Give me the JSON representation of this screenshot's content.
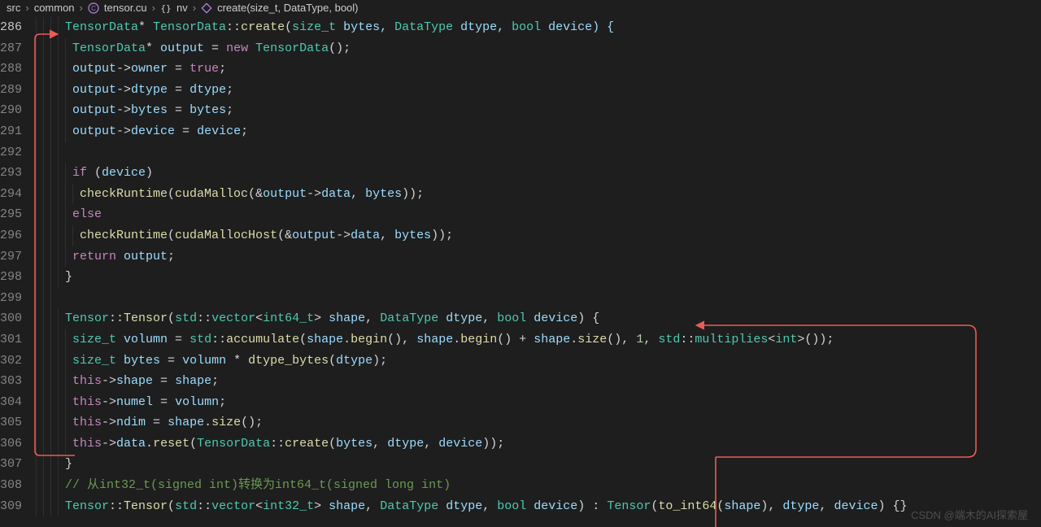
{
  "breadcrumbs": {
    "parts": [
      "src",
      "common",
      "tensor.cu",
      "nv",
      "create(size_t, DataType, bool)"
    ],
    "sep": "›"
  },
  "lines": {
    "start": 286,
    "cur": 286,
    "end": 309
  },
  "code": {
    "l286": {
      "t1": "TensorData",
      "t2": "* ",
      "t3": "TensorData",
      "t4": "::",
      "t5": "create",
      "t6": "(",
      "t7": "size_t",
      "t8": " bytes, ",
      "t9": "DataType",
      "t10": " dtype, ",
      "t11": "bool",
      "t12": " device) {"
    },
    "l287": {
      "t1": "TensorData",
      "t2": "* ",
      "t3": "output",
      "t4": " = ",
      "t5": "new",
      "t6": " ",
      "t7": "TensorData",
      "t8": "();"
    },
    "l288": {
      "t1": "output",
      "t2": "->",
      "t3": "owner",
      "t4": " = ",
      "t5": "true",
      "t6": ";"
    },
    "l289": {
      "t1": "output",
      "t2": "->",
      "t3": "dtype",
      "t4": " = ",
      "t5": "dtype",
      "t6": ";"
    },
    "l290": {
      "t1": "output",
      "t2": "->",
      "t3": "bytes",
      "t4": " = ",
      "t5": "bytes",
      "t6": ";"
    },
    "l291": {
      "t1": "output",
      "t2": "->",
      "t3": "device",
      "t4": " = ",
      "t5": "device",
      "t6": ";"
    },
    "l293": {
      "t1": "if",
      "t2": " (",
      "t3": "device",
      "t4": ")"
    },
    "l294": {
      "t1": "checkRuntime",
      "t2": "(",
      "t3": "cudaMalloc",
      "t4": "(&",
      "t5": "output",
      "t6": "->",
      "t7": "data",
      "t8": ", ",
      "t9": "bytes",
      "t10": "));"
    },
    "l295": {
      "t1": "else"
    },
    "l296": {
      "t1": "checkRuntime",
      "t2": "(",
      "t3": "cudaMallocHost",
      "t4": "(&",
      "t5": "output",
      "t6": "->",
      "t7": "data",
      "t8": ", ",
      "t9": "bytes",
      "t10": "));"
    },
    "l297": {
      "t1": "return",
      "t2": " ",
      "t3": "output",
      "t4": ";"
    },
    "l298": {
      "t1": "}"
    },
    "l300": {
      "t1": "Tensor",
      "t2": "::",
      "t3": "Tensor",
      "t4": "(",
      "t5": "std",
      "t6": "::",
      "t7": "vector",
      "t8": "<",
      "t9": "int64_t",
      "t10": "> ",
      "t11": "shape",
      "t12": ", ",
      "t13": "DataType",
      "t14": " ",
      "t15": "dtype",
      "t16": ", ",
      "t17": "bool",
      "t18": " ",
      "t19": "device",
      "t20": ") {"
    },
    "l301": {
      "t1": "size_t",
      "t2": " ",
      "t3": "volumn",
      "t4": " = ",
      "t5": "std",
      "t6": "::",
      "t7": "accumulate",
      "t8": "(",
      "t9": "shape",
      "t10": ".",
      "t11": "begin",
      "t12": "(), ",
      "t13": "shape",
      "t14": ".",
      "t15": "begin",
      "t16": "() + ",
      "t17": "shape",
      "t18": ".",
      "t19": "size",
      "t20": "(), ",
      "t21": "1",
      "t22": ", ",
      "t23": "std",
      "t24": "::",
      "t25": "multiplies",
      "t26": "<",
      "t27": "int",
      "t28": ">());"
    },
    "l302": {
      "t1": "size_t",
      "t2": " ",
      "t3": "bytes",
      "t4": " = ",
      "t5": "volumn",
      "t6": " * ",
      "t7": "dtype_bytes",
      "t8": "(",
      "t9": "dtype",
      "t10": ");"
    },
    "l303": {
      "t1": "this",
      "t2": "->",
      "t3": "shape",
      "t4": " = ",
      "t5": "shape",
      "t6": ";"
    },
    "l304": {
      "t1": "this",
      "t2": "->",
      "t3": "numel",
      "t4": " = ",
      "t5": "volumn",
      "t6": ";"
    },
    "l305": {
      "t1": "this",
      "t2": "->",
      "t3": "ndim",
      "t4": " = ",
      "t5": "shape",
      "t6": ".",
      "t7": "size",
      "t8": "();"
    },
    "l306": {
      "t1": "this",
      "t2": "->",
      "t3": "data",
      "t4": ".",
      "t5": "reset",
      "t6": "(",
      "t7": "TensorData",
      "t8": "::",
      "t9": "create",
      "t10": "(",
      "t11": "bytes",
      "t12": ", ",
      "t13": "dtype",
      "t14": ", ",
      "t15": "device",
      "t16": "));"
    },
    "l307": {
      "t1": "}"
    },
    "l308": {
      "t1": "// 从int32_t(signed int)转换为int64_t(signed long int)"
    },
    "l309": {
      "t1": "Tensor",
      "t2": "::",
      "t3": "Tensor",
      "t4": "(",
      "t5": "std",
      "t6": "::",
      "t7": "vector",
      "t8": "<",
      "t9": "int32_t",
      "t10": "> ",
      "t11": "shape",
      "t12": ", ",
      "t13": "DataType",
      "t14": " ",
      "t15": "dtype",
      "t16": ", ",
      "t17": "bool",
      "t18": " ",
      "t19": "device",
      "t20": ") : ",
      "t21": "Tensor",
      "t22": "(",
      "t23": "to_int64",
      "t24": "(",
      "t25": "shape",
      "t26": "), ",
      "t27": "dtype",
      "t28": ", ",
      "t29": "device",
      "t30": ") {}"
    }
  },
  "watermark": "CSDN @端木的AI探索屋"
}
